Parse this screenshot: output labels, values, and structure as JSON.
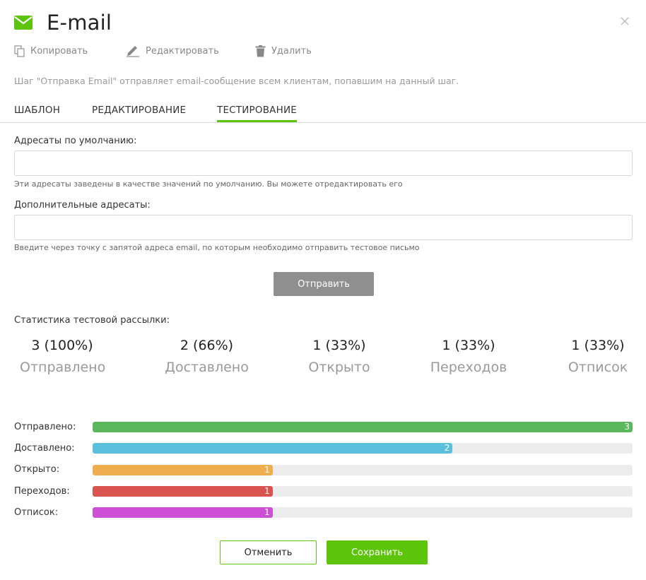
{
  "header": {
    "title": "E-mail",
    "icon": "mail-icon",
    "icon_color": "#5cc40a"
  },
  "toolbar": {
    "copy_label": "Копировать",
    "edit_label": "Редактировать",
    "delete_label": "Удалить"
  },
  "description": "Шаг \"Отправка Email\" отправляет email-сообщение всем клиентам, попавшим на данный шаг.",
  "tabs": [
    {
      "label": "ШАБЛОН",
      "active": false
    },
    {
      "label": "РЕДАКТИРОВАНИЕ",
      "active": false
    },
    {
      "label": "ТЕСТИРОВАНИЕ",
      "active": true
    }
  ],
  "form": {
    "default_label": "Адресаты по умолчанию:",
    "default_value": "",
    "default_hint": "Эти адресаты заведены в качестве значений по умолчанию. Вы можете отредактировать его",
    "extra_label": "Дополнительные адресаты:",
    "extra_value": "",
    "extra_hint": "Введите через точку с запятой адреса email, по которым необходимо отправить тестовое письмо",
    "send_label": "Отправить"
  },
  "stats": {
    "title": "Статистика тестовой рассылки:",
    "items": [
      {
        "value": "3 (100%)",
        "label": "Отправлено"
      },
      {
        "value": "2 (66%)",
        "label": "Доставлено"
      },
      {
        "value": "1 (33%)",
        "label": "Открыто"
      },
      {
        "value": "1 (33%)",
        "label": "Переходов"
      },
      {
        "value": "1 (33%)",
        "label": "Отписок"
      }
    ]
  },
  "bars": {
    "max": 3,
    "items": [
      {
        "label": "Отправлено:",
        "value": 3,
        "color": "#5cb85c"
      },
      {
        "label": "Доставлено:",
        "value": 2,
        "color": "#5bc0de"
      },
      {
        "label": "Открыто:",
        "value": 1,
        "color": "#f0ad4e"
      },
      {
        "label": "Переходов:",
        "value": 1,
        "color": "#d9534f"
      },
      {
        "label": "Отписок:",
        "value": 1,
        "color": "#cc4fd6"
      }
    ]
  },
  "footer": {
    "cancel_label": "Отменить",
    "save_label": "Сохранить"
  }
}
